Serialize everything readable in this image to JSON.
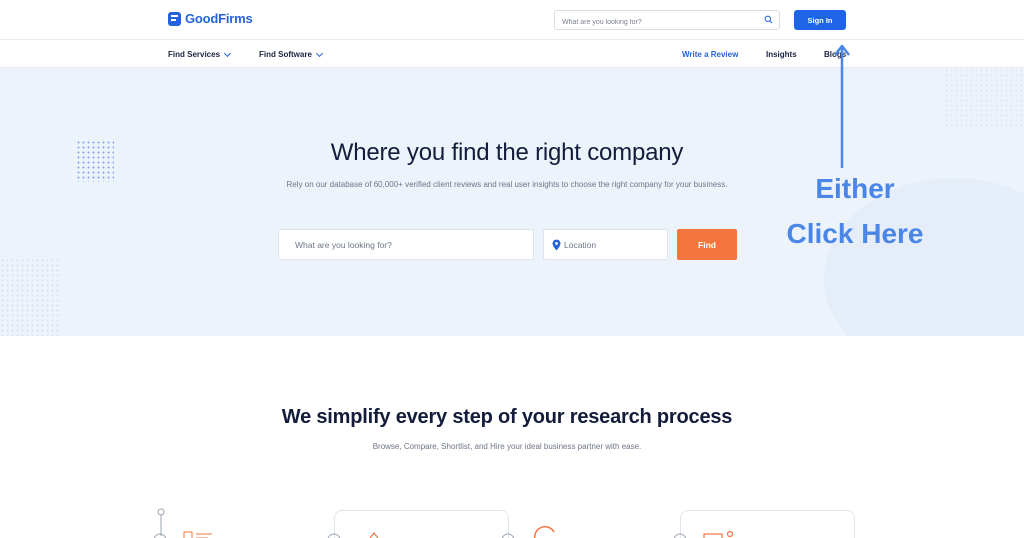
{
  "brand": {
    "name": "GoodFirms",
    "color": "#2563d9"
  },
  "topbar": {
    "search_placeholder": "What are you looking for?",
    "search_icon": "search-icon",
    "signin_label": "Sign In"
  },
  "nav": {
    "menus": [
      {
        "label": "Find Services"
      },
      {
        "label": "Find Software"
      }
    ],
    "links": [
      {
        "label": "Write a Review"
      },
      {
        "label": "Insights"
      },
      {
        "label": "Blogs"
      }
    ]
  },
  "hero": {
    "title": "Where you find the right company",
    "subtitle": "Rely on our database of 60,000+ verified client reviews and real user insights to choose the right company for your business.",
    "search_placeholder": "What are you looking for?",
    "location_placeholder": "Location",
    "find_label": "Find",
    "find_color": "#f47540"
  },
  "annotation": {
    "line1": "Either",
    "line2": "Click Here",
    "color": "#4a86e8"
  },
  "process": {
    "title": "We simplify every step of your research process",
    "subtitle": "Browse, Compare, Shortlist, and Hire your ideal business partner with ease."
  }
}
